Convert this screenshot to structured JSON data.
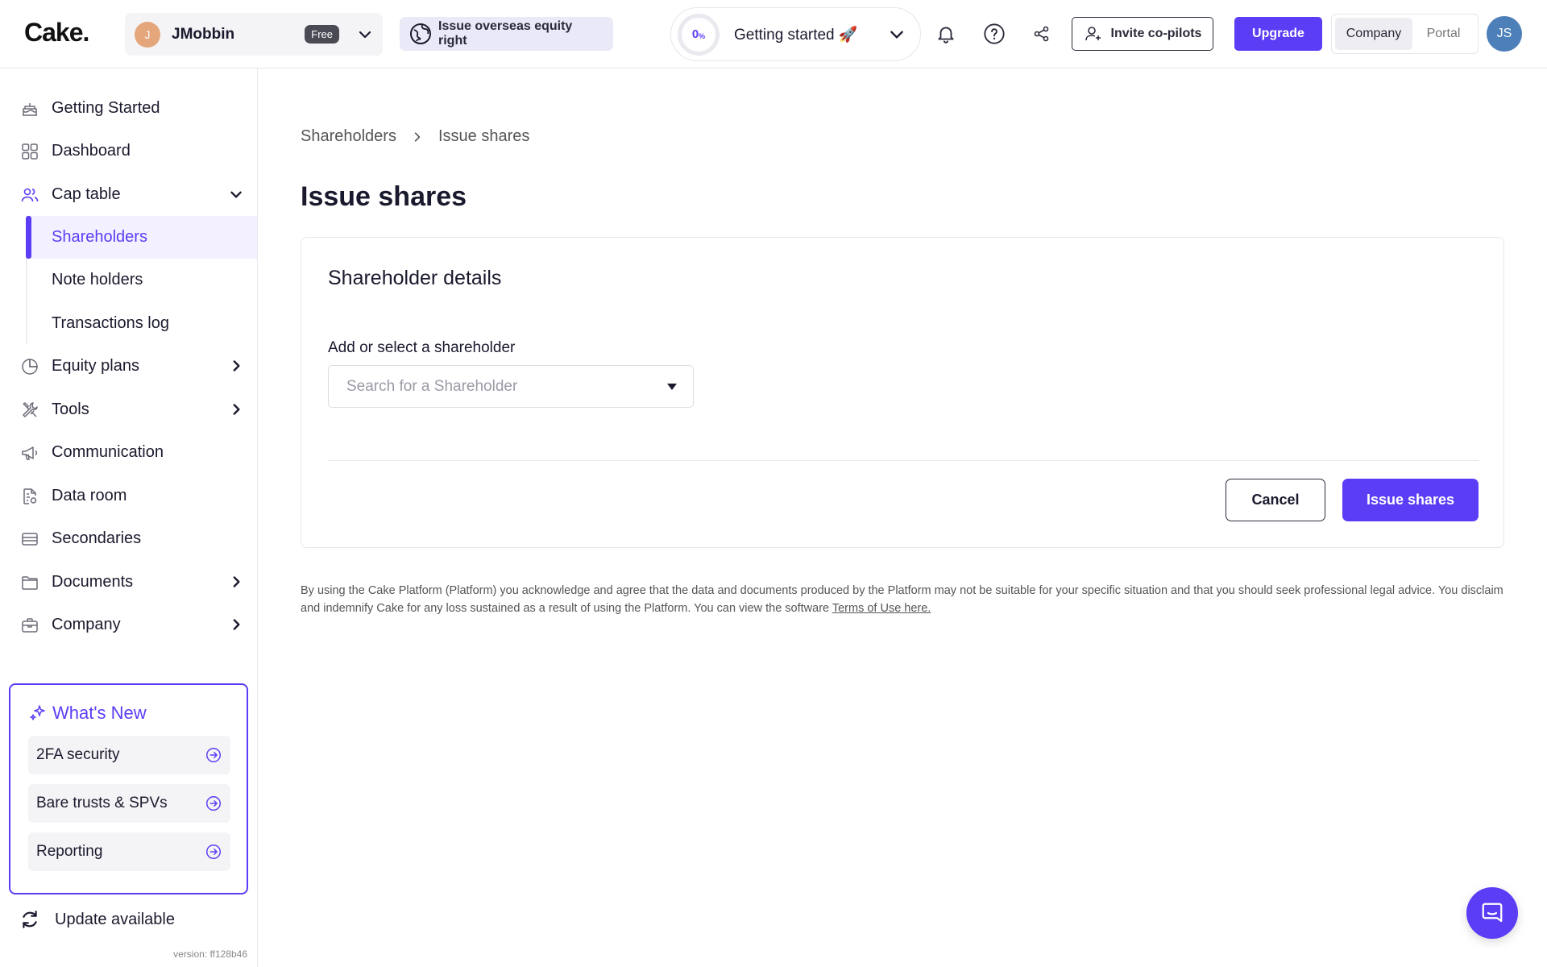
{
  "header": {
    "logo": "Cake.",
    "account": {
      "initial": "J",
      "name": "JMobbin",
      "plan_badge": "Free"
    },
    "equity_pill": "Issue overseas equity right",
    "getting_started": {
      "percent": "0",
      "percent_unit": "%",
      "label": "Getting started 🚀"
    },
    "invite_label": "Invite co-pilots",
    "upgrade_label": "Upgrade",
    "switch": {
      "company": "Company",
      "portal": "Portal"
    },
    "user_initials": "JS"
  },
  "sidebar": {
    "items": [
      {
        "label": "Getting Started",
        "icon": "cake-icon"
      },
      {
        "label": "Dashboard",
        "icon": "grid-icon"
      },
      {
        "label": "Cap table",
        "icon": "users-icon"
      },
      {
        "label": "Equity plans",
        "icon": "pie-icon"
      },
      {
        "label": "Tools",
        "icon": "tools-icon"
      },
      {
        "label": "Communication",
        "icon": "megaphone-icon"
      },
      {
        "label": "Data room",
        "icon": "data-room-icon"
      },
      {
        "label": "Secondaries",
        "icon": "card-icon"
      },
      {
        "label": "Documents",
        "icon": "folder-icon"
      },
      {
        "label": "Company",
        "icon": "briefcase-icon"
      }
    ],
    "cap_table_sub": [
      "Shareholders",
      "Note holders",
      "Transactions log"
    ],
    "whats_new": {
      "title": "What's New",
      "items": [
        "2FA security",
        "Bare trusts & SPVs",
        "Reporting"
      ]
    },
    "update_label": "Update available",
    "version": "version: ff128b46"
  },
  "main": {
    "breadcrumb": [
      "Shareholders",
      "Issue shares"
    ],
    "title": "Issue shares",
    "card": {
      "title": "Shareholder details",
      "field_label": "Add or select a shareholder",
      "placeholder": "Search for a Shareholder",
      "cancel_label": "Cancel",
      "submit_label": "Issue shares"
    },
    "disclaimer": "By using the Cake Platform (Platform) you acknowledge and agree that the data and documents produced by the Platform may not be suitable for your specific situation and that you should seek professional legal advice. You disclaim and indemnify Cake for any loss sustained as a result of using the Platform. You can view the software ",
    "terms_link": "Terms of Use here."
  },
  "colors": {
    "accent": "#5b3df5",
    "active_bg": "#f3f1ff",
    "text": "#1a1a2e"
  }
}
